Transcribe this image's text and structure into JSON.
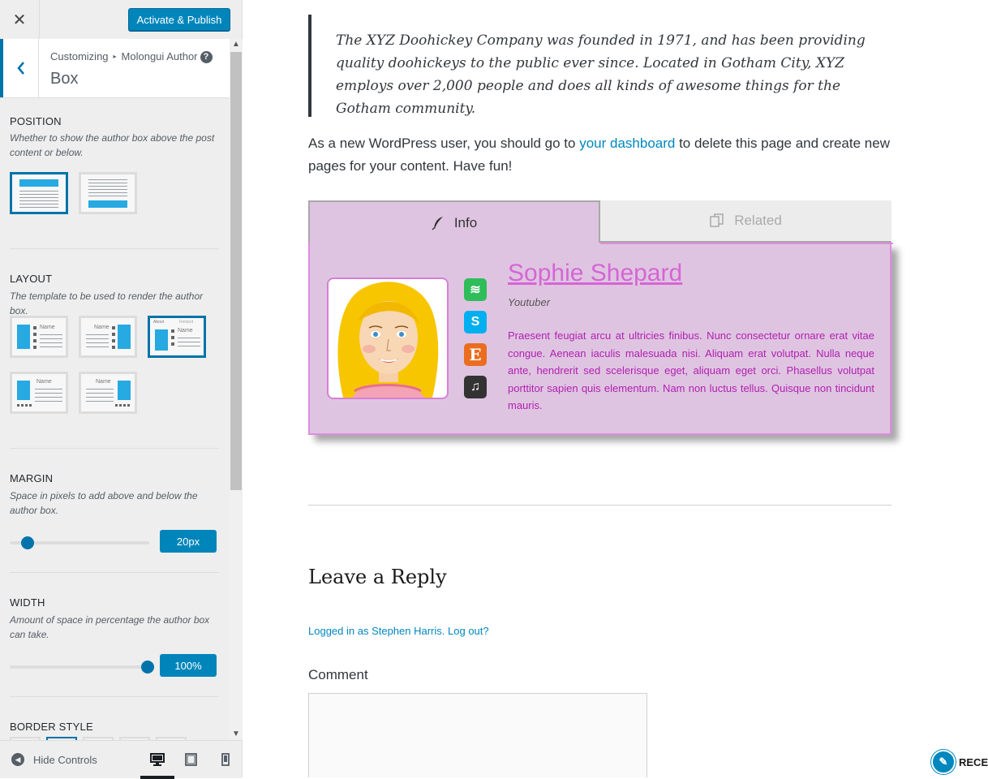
{
  "header": {
    "close_label": "✕",
    "publish_label": "Activate & Publish"
  },
  "section": {
    "breadcrumb_root": "Customizing",
    "breadcrumb_parent": "Molongui Author",
    "help_label": "?",
    "title": "Box"
  },
  "controls": {
    "position": {
      "label": "POSITION",
      "description": "Whether to show the author box above the post content or below.",
      "options": [
        "above",
        "below"
      ],
      "selected": "above"
    },
    "layout": {
      "label": "LAYOUT",
      "description": "The template to be used to render the author box.",
      "thumb_name_text": "Name",
      "thumb_tab_about": "About",
      "thumb_tab_related": "Related",
      "selected_index": 2
    },
    "margin": {
      "label": "MARGIN",
      "description": "Space in pixels to add above and below the author box.",
      "value_label": "20px",
      "value_fraction": 0.13
    },
    "width": {
      "label": "WIDTH",
      "description": "Amount of space in percentage the author box can take.",
      "value_label": "100%",
      "value_fraction": 1.0
    },
    "border_style": {
      "label": "BORDER STYLE"
    }
  },
  "footer": {
    "hide_controls_label": "Hide Controls",
    "devices": [
      "desktop-icon",
      "tablet-icon",
      "mobile-icon"
    ],
    "active_device": "desktop"
  },
  "preview": {
    "quote": "The XYZ Doohickey Company was founded in 1971, and has been providing quality doohickeys to the public ever since. Located in Gotham City, XYZ employs over 2,000 people and does all kinds of awesome things for the Gotham community.",
    "para_before": "As a new WordPress user, you should go to ",
    "para_link": "your dashboard",
    "para_after": " to delete this page and create new pages for your content. Have fun!",
    "author_box": {
      "tab_info": "Info",
      "tab_related": "Related",
      "name": "Sophie Shepard",
      "job": "Youtuber",
      "bio": "Praesent feugiat arcu at ultricies finibus. Nunc consectetur ornare erat vitae congue. Aenean iaculis malesuada nisi. Aliquam erat volutpat. Nulla neque ante, hendrerit sed scelerisque eget, aliquam eget orci. Phasellus volutpat porttitor sapien quis elementum. Nam non luctus tellus. Quisque non tincidunt mauris.",
      "socials": [
        {
          "icon": "spotify-icon",
          "color": "#2ebd59",
          "glyph": "≋"
        },
        {
          "icon": "skype-icon",
          "color": "#00aff0",
          "glyph": "S"
        },
        {
          "icon": "etsy-icon",
          "color": "#eb6d20",
          "glyph": "E"
        },
        {
          "icon": "itunes-icon",
          "color": "#333333",
          "glyph": "♫"
        }
      ],
      "accent_color": "#d466d4",
      "background_color": "#dfc4e1"
    },
    "reply_title": "Leave a Reply",
    "logged_in_text": "Logged in as Stephen Harris.",
    "logout_text": "Log out?",
    "comment_label": "Comment",
    "recent_label": "RECEN"
  }
}
